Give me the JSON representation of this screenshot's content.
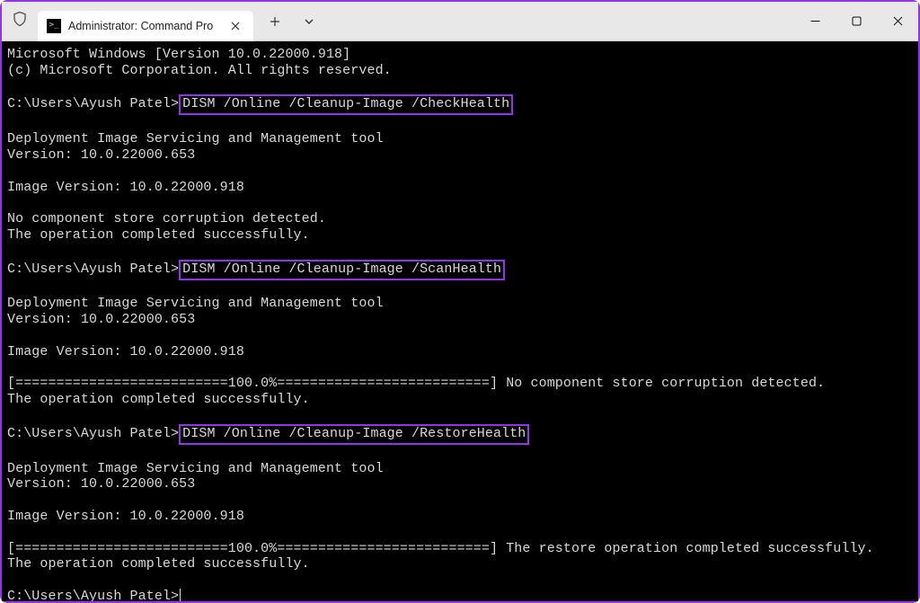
{
  "window": {
    "tab_title": "Administrator: Command Pro"
  },
  "terminal": {
    "header_line1": "Microsoft Windows [Version 10.0.22000.918]",
    "header_line2": "(c) Microsoft Corporation. All rights reserved.",
    "prompt": "C:\\Users\\Ayush Patel>",
    "cmd1": "DISM /Online /Cleanup-Image /CheckHealth",
    "tool_line": "Deployment Image Servicing and Management tool",
    "tool_version": "Version: 10.0.22000.653",
    "image_version": "Image Version: 10.0.22000.918",
    "check_result1": "No component store corruption detected.",
    "op_success": "The operation completed successfully.",
    "cmd2": "DISM /Online /Cleanup-Image /ScanHealth",
    "scan_progress": "[==========================100.0%==========================] No component store corruption detected.",
    "cmd3": "DISM /Online /Cleanup-Image /RestoreHealth",
    "restore_progress": "[==========================100.0%==========================] The restore operation completed successfully."
  }
}
